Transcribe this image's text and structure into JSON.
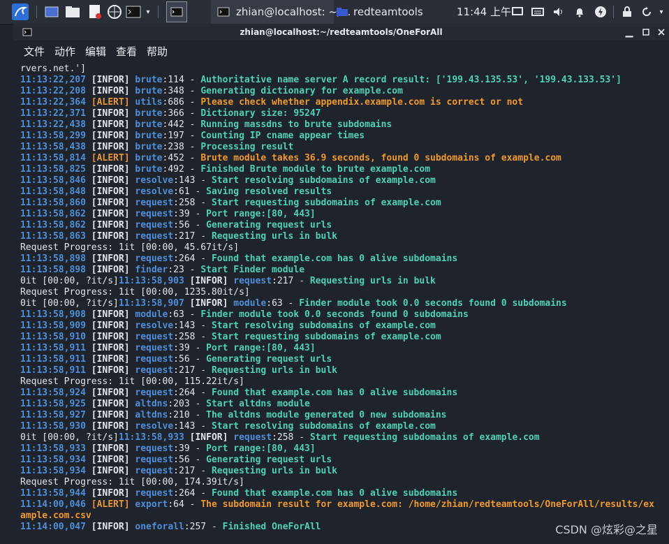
{
  "panel": {
    "task1_label": "zhian@localhost: ~/...",
    "task2_label": "redteamtools",
    "clock": "11:44 上午"
  },
  "window": {
    "title": "zhian@localhost:~/redteamtools/OneForAll"
  },
  "menu": [
    "文件",
    "动作",
    "编辑",
    "查看",
    "帮助"
  ],
  "lines": [
    {
      "kind": "plain",
      "text": "rvers.net.']"
    },
    {
      "kind": "log",
      "ts": "11:13:22,207",
      "level": "INFOR",
      "module": "brute",
      "lineno": "114",
      "msg": "Authoritative name server A record result: ['199.43.135.53', '199.43.133.53']"
    },
    {
      "kind": "log",
      "ts": "11:13:22,208",
      "level": "INFOR",
      "module": "brute",
      "lineno": "348",
      "msg": "Generating dictionary for example.com"
    },
    {
      "kind": "log",
      "ts": "11:13:22,364",
      "level": "ALERT",
      "module": "utils",
      "lineno": "686",
      "msg": "Please check whether appendix.example.com is correct or not"
    },
    {
      "kind": "log",
      "ts": "11:13:22,371",
      "level": "INFOR",
      "module": "brute",
      "lineno": "366",
      "msg": "Dictionary size: 95247"
    },
    {
      "kind": "log",
      "ts": "11:13:22,438",
      "level": "INFOR",
      "module": "brute",
      "lineno": "442",
      "msg": "Running massdns to brute subdomains"
    },
    {
      "kind": "log",
      "ts": "11:13:58,299",
      "level": "INFOR",
      "module": "brute",
      "lineno": "197",
      "msg": "Counting IP cname appear times"
    },
    {
      "kind": "log",
      "ts": "11:13:58,438",
      "level": "INFOR",
      "module": "brute",
      "lineno": "238",
      "msg": "Processing result"
    },
    {
      "kind": "log",
      "ts": "11:13:58,814",
      "level": "ALERT",
      "module": "brute",
      "lineno": "452",
      "msg": "Brute module takes 36.9 seconds, found 0 subdomains of example.com"
    },
    {
      "kind": "log",
      "ts": "11:13:58,825",
      "level": "INFOR",
      "module": "brute",
      "lineno": "492",
      "msg": "Finished Brute module to brute example.com"
    },
    {
      "kind": "log",
      "ts": "11:13:58,846",
      "level": "INFOR",
      "module": "resolve",
      "lineno": "143",
      "msg": "Start resolving subdomains of example.com"
    },
    {
      "kind": "log",
      "ts": "11:13:58,848",
      "level": "INFOR",
      "module": "resolve",
      "lineno": "61",
      "msg": "Saving resolved results"
    },
    {
      "kind": "log",
      "ts": "11:13:58,860",
      "level": "INFOR",
      "module": "request",
      "lineno": "258",
      "msg": "Start requesting subdomains of example.com"
    },
    {
      "kind": "log",
      "ts": "11:13:58,862",
      "level": "INFOR",
      "module": "request",
      "lineno": "39",
      "msg": "Port range:[80, 443]"
    },
    {
      "kind": "log",
      "ts": "11:13:58,862",
      "level": "INFOR",
      "module": "request",
      "lineno": "56",
      "msg": "Generating request urls"
    },
    {
      "kind": "log",
      "ts": "11:13:58,863",
      "level": "INFOR",
      "module": "request",
      "lineno": "217",
      "msg": "Requesting urls in bulk"
    },
    {
      "kind": "plain",
      "text": "Request Progress: 1it [00:00, 45.67it/s]"
    },
    {
      "kind": "log",
      "ts": "11:13:58,898",
      "level": "INFOR",
      "module": "request",
      "lineno": "264",
      "msg": "Found that example.com has 0 alive subdomains"
    },
    {
      "kind": "log",
      "ts": "11:13:58,898",
      "level": "INFOR",
      "module": "finder",
      "lineno": "23",
      "msg": "Start Finder module"
    },
    {
      "kind": "log",
      "prefix": "0it [00:00, ?it/s]",
      "ts": "11:13:58,903",
      "level": "INFOR",
      "module": "request",
      "lineno": "217",
      "msg": "Requesting urls in bulk"
    },
    {
      "kind": "plain",
      "text": "Request Progress: 1it [00:00, 1235.80it/s]"
    },
    {
      "kind": "log",
      "prefix": "0it [00:00, ?it/s]",
      "ts": "11:13:58,907",
      "level": "INFOR",
      "module": "module",
      "lineno": "63",
      "msg": "Finder module took 0.0 seconds found 0 subdomains"
    },
    {
      "kind": "log",
      "ts": "11:13:58,908",
      "level": "INFOR",
      "module": "module",
      "lineno": "63",
      "msg": "Finder module took 0.0 seconds found 0 subdomains"
    },
    {
      "kind": "log",
      "ts": "11:13:58,909",
      "level": "INFOR",
      "module": "resolve",
      "lineno": "143",
      "msg": "Start resolving subdomains of example.com"
    },
    {
      "kind": "log",
      "ts": "11:13:58,910",
      "level": "INFOR",
      "module": "request",
      "lineno": "258",
      "msg": "Start requesting subdomains of example.com"
    },
    {
      "kind": "log",
      "ts": "11:13:58,911",
      "level": "INFOR",
      "module": "request",
      "lineno": "39",
      "msg": "Port range:[80, 443]"
    },
    {
      "kind": "log",
      "ts": "11:13:58,911",
      "level": "INFOR",
      "module": "request",
      "lineno": "56",
      "msg": "Generating request urls"
    },
    {
      "kind": "log",
      "ts": "11:13:58,911",
      "level": "INFOR",
      "module": "request",
      "lineno": "217",
      "msg": "Requesting urls in bulk"
    },
    {
      "kind": "plain",
      "text": "Request Progress: 1it [00:00, 115.22it/s]"
    },
    {
      "kind": "log",
      "ts": "11:13:58,924",
      "level": "INFOR",
      "module": "request",
      "lineno": "264",
      "msg": "Found that example.com has 0 alive subdomains"
    },
    {
      "kind": "log",
      "ts": "11:13:58,925",
      "level": "INFOR",
      "module": "altdns",
      "lineno": "203",
      "msg": "Start altdns module"
    },
    {
      "kind": "log",
      "ts": "11:13:58,927",
      "level": "INFOR",
      "module": "altdns",
      "lineno": "210",
      "msg": "The altdns module generated 0 new subdomains"
    },
    {
      "kind": "log",
      "ts": "11:13:58,930",
      "level": "INFOR",
      "module": "resolve",
      "lineno": "143",
      "msg": "Start resolving subdomains of example.com"
    },
    {
      "kind": "log",
      "prefix": "0it [00:00, ?it/s]",
      "ts": "11:13:58,933",
      "level": "INFOR",
      "module": "request",
      "lineno": "258",
      "msg": "Start requesting subdomains of example.com"
    },
    {
      "kind": "log",
      "ts": "11:13:58,933",
      "level": "INFOR",
      "module": "request",
      "lineno": "39",
      "msg": "Port range:[80, 443]"
    },
    {
      "kind": "log",
      "ts": "11:13:58,934",
      "level": "INFOR",
      "module": "request",
      "lineno": "56",
      "msg": "Generating request urls"
    },
    {
      "kind": "log",
      "ts": "11:13:58,934",
      "level": "INFOR",
      "module": "request",
      "lineno": "217",
      "msg": "Requesting urls in bulk"
    },
    {
      "kind": "plain",
      "text": "Request Progress: 1it [00:00, 174.39it/s]"
    },
    {
      "kind": "log",
      "ts": "11:13:58,944",
      "level": "INFOR",
      "module": "request",
      "lineno": "264",
      "msg": "Found that example.com has 0 alive subdomains"
    },
    {
      "kind": "log",
      "ts": "11:14:00,046",
      "level": "ALERT",
      "module": "export",
      "lineno": "64",
      "msg": "The subdomain result for example.com: /home/zhian/redteamtools/OneForAll/results/ex"
    },
    {
      "kind": "cont",
      "level": "ALERT",
      "text": "ample.com.csv"
    },
    {
      "kind": "log",
      "ts": "11:14:00,047",
      "level": "INFOR",
      "module": "oneforall",
      "lineno": "257",
      "msg": "Finished OneForAll"
    }
  ],
  "watermark": "CSDN @炫彩@之星",
  "colors": {
    "timestamp": "#4f8fd9",
    "info_msg": "#4fd1b8",
    "alert": "#f0992e",
    "panel_bg": "#2a2e36",
    "terminal_bg": "#1f232b"
  }
}
